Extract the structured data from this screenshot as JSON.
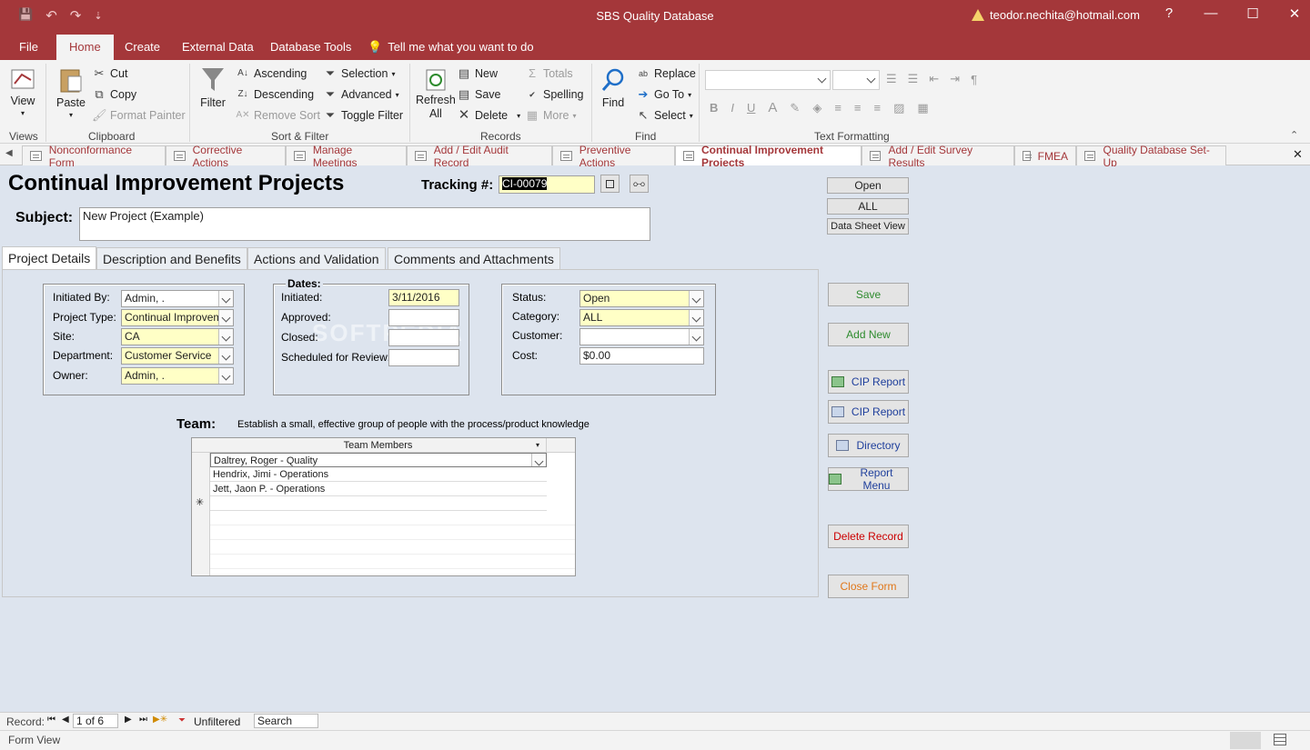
{
  "window": {
    "title": "SBS Quality Database",
    "user": "teodor.nechita@hotmail.com",
    "help": "?",
    "minimize": "—",
    "maximize": "☐",
    "close": "✕"
  },
  "qat": {
    "save": "💾",
    "undo": "↶",
    "redo": "↷",
    "more": "⇣"
  },
  "ribbon_tabs": [
    "File",
    "Home",
    "Create",
    "External Data",
    "Database Tools"
  ],
  "tell_me": "Tell me what you want to do",
  "ribbon": {
    "views": {
      "view": "View",
      "group": "Views"
    },
    "clipboard": {
      "paste": "Paste",
      "cut": "Cut",
      "copy": "Copy",
      "format_painter": "Format Painter",
      "group": "Clipboard"
    },
    "sort_filter": {
      "filter": "Filter",
      "ascending": "Ascending",
      "descending": "Descending",
      "remove_sort": "Remove Sort",
      "selection": "Selection",
      "advanced": "Advanced",
      "toggle_filter": "Toggle Filter",
      "group": "Sort & Filter"
    },
    "records": {
      "refresh": "Refresh",
      "refresh_all": "All",
      "new": "New",
      "save": "Save",
      "delete": "Delete",
      "totals": "Totals",
      "spelling": "Spelling",
      "more": "More",
      "group": "Records"
    },
    "find": {
      "find": "Find",
      "replace": "Replace",
      "goto": "Go To",
      "select": "Select",
      "group": "Find"
    },
    "text_formatting": {
      "bold": "B",
      "italic": "I",
      "underline": "U",
      "font_color": "A",
      "group": "Text Formatting"
    }
  },
  "doc_tabs": [
    "Nonconformance Form",
    "Corrective Actions",
    "Manage Meetings",
    "Add / Edit Audit Record",
    "Preventive Actions",
    "Continual Improvement Projects",
    "Add / Edit Survey Results",
    "FMEA",
    "Quality Database Set-Up"
  ],
  "form": {
    "heading": "Continual Improvement Projects",
    "tracking_label": "Tracking #:",
    "tracking_value": "CI-00079",
    "subject_label": "Subject:",
    "subject_value": "New Project (Example)",
    "tabs": [
      "Project Details",
      "Description and Benefits",
      "Actions and Validation",
      "Comments and Attachments"
    ],
    "left_group": {
      "initiated_by_label": "Initiated By:",
      "initiated_by": "Admin, .",
      "project_type_label": "Project Type:",
      "project_type": "Continual Improvement",
      "site_label": "Site:",
      "site": "CA",
      "department_label": "Department:",
      "department": "Customer Service",
      "owner_label": "Owner:",
      "owner": "Admin, ."
    },
    "dates_group": {
      "caption": "Dates:",
      "initiated_label": "Initiated:",
      "initiated": "3/11/2016",
      "approved_label": "Approved:",
      "approved": "",
      "closed_label": "Closed:",
      "closed": "",
      "review_label": "Scheduled for Review:",
      "review": ""
    },
    "status_group": {
      "status_label": "Status:",
      "status": "Open",
      "category_label": "Category:",
      "category": "ALL",
      "customer_label": "Customer:",
      "customer": "",
      "cost_label": "Cost:",
      "cost": "$0.00"
    },
    "team": {
      "label": "Team:",
      "description": "Establish a small, effective group of people with the process/product knowledge",
      "column": "Team Members",
      "members": [
        "Daltrey, Roger  - Quality",
        "Hendrix, Jimi  - Operations",
        "Jett, Jaon P. - Operations"
      ],
      "new_row_marker": "✳"
    },
    "buttons": {
      "open": "Open",
      "all": "ALL",
      "datasheet": "Data Sheet View",
      "save": "Save",
      "add_new": "Add New",
      "cip_report_1": "CIP Report",
      "cip_report_2": "CIP Report",
      "directory": "Directory",
      "report_menu": "Report Menu",
      "delete_record": "Delete Record",
      "close_form": "Close Form"
    }
  },
  "record_nav": {
    "label": "Record:",
    "position": "1 of 6",
    "filter": "Unfiltered",
    "search": "Search"
  },
  "status": {
    "view": "Form View"
  },
  "colors": {
    "accent": "#a4373a",
    "field_highlight": "#ffffc6",
    "green_text": "#2e8b2e",
    "red_text": "#cc0000",
    "orange_text": "#e0771a",
    "blue_text": "#1f3f9c"
  }
}
